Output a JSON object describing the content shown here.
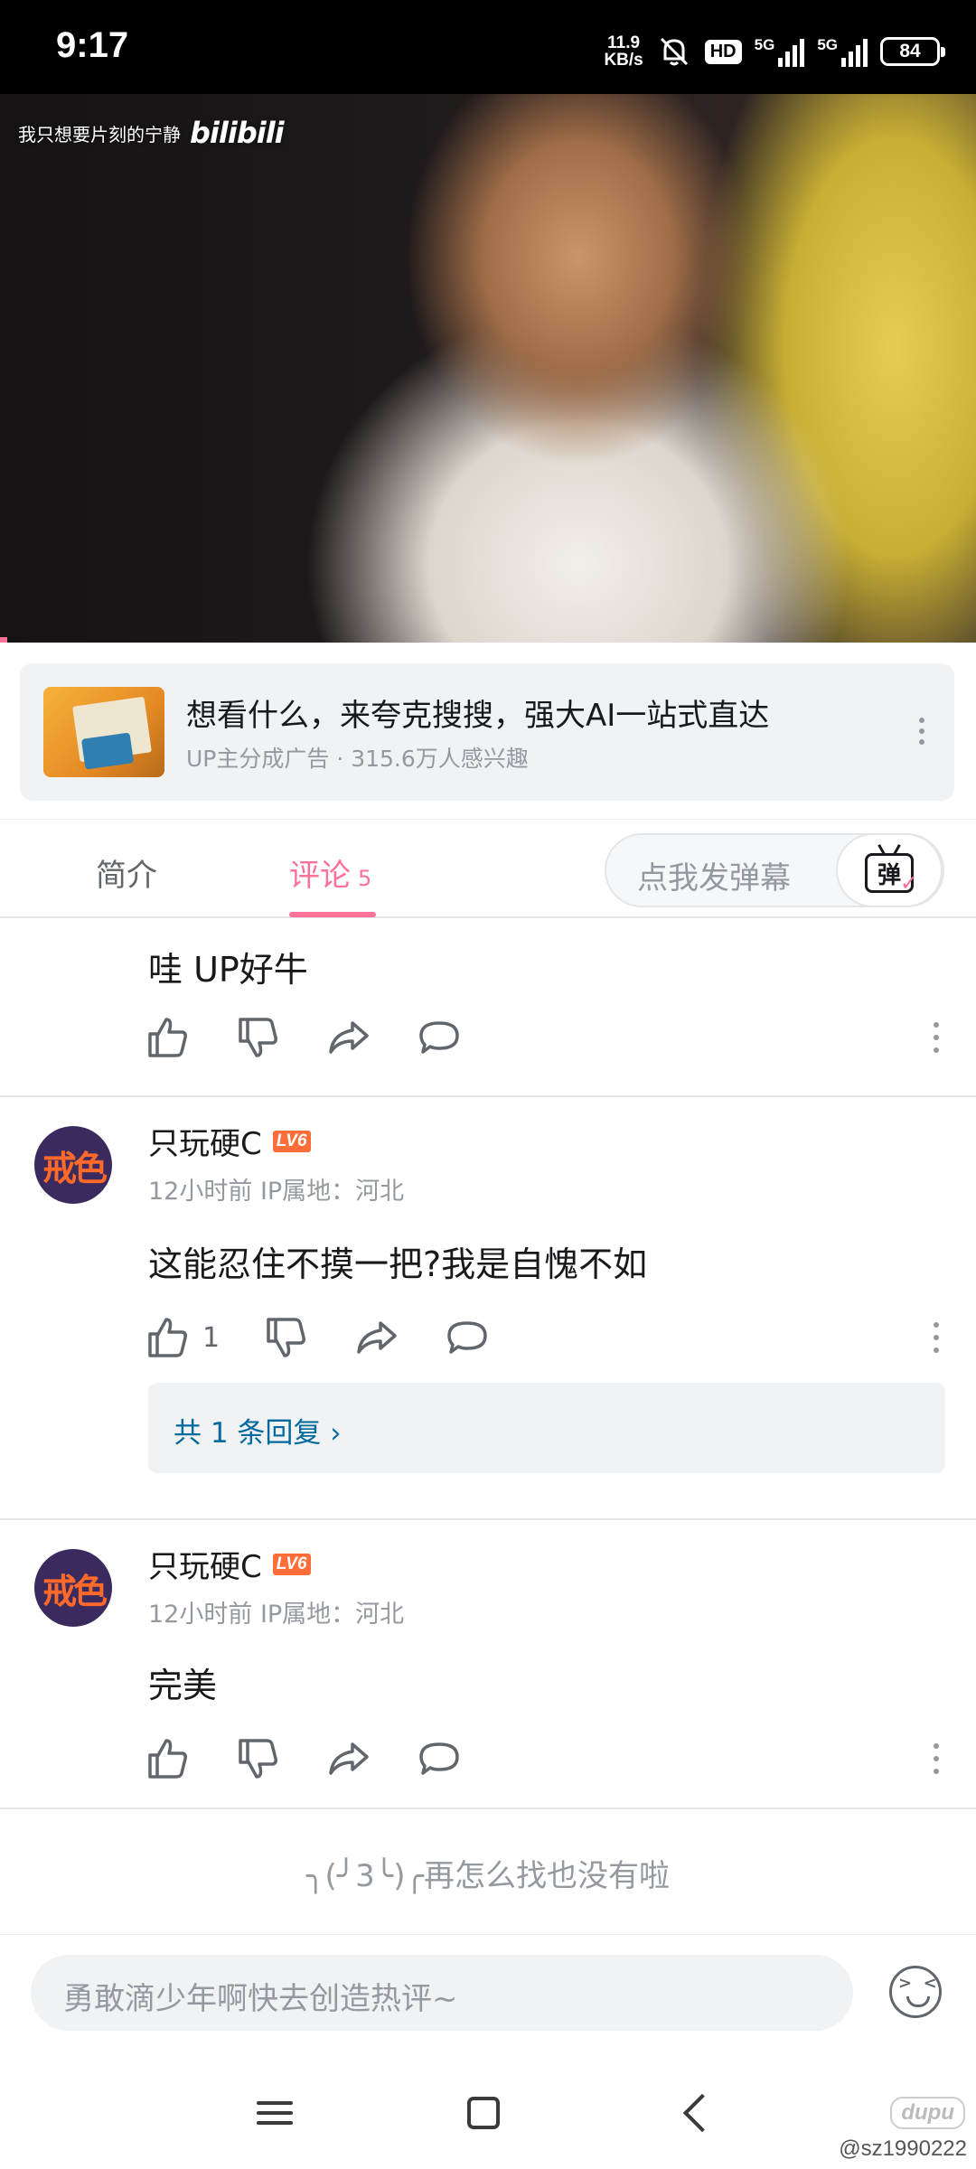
{
  "status_bar": {
    "time": "9:17",
    "net_speed_value": "11.9",
    "net_speed_unit": "KB/s",
    "hd_label": "HD",
    "sim1_label": "5G",
    "sim2_label": "5G",
    "battery": "84"
  },
  "video": {
    "watermark_text": "我只想要片刻的宁静",
    "logo_text": "bilibili"
  },
  "ad": {
    "title": "想看什么，来夸克搜搜，强大AI一站式直达",
    "subtitle": "UP主分成广告 · 315.6万人感兴趣"
  },
  "tabs": {
    "intro": "简介",
    "comments": "评论",
    "comments_count": "5",
    "danmaku_placeholder": "点我发弹幕",
    "danmaku_icon_char": "弹"
  },
  "comments": [
    {
      "text": "哇 UP好牛"
    },
    {
      "avatar_text": "戒色",
      "username": "只玩硬C",
      "level": "LV6",
      "meta": "12小时前 IP属地：河北",
      "text": "这能忍住不摸一把?我是自愧不如",
      "likes": "1",
      "replies_label": "共 1 条回复 ›"
    },
    {
      "avatar_text": "戒色",
      "username": "只玩硬C",
      "level": "LV6",
      "meta": "12小时前 IP属地：河北",
      "text": "完美"
    }
  ],
  "end_text": "╮(╯3╰)╭再怎么找也没有啦",
  "input": {
    "placeholder": "勇敢滴少年啊快去创造热评~"
  },
  "watermark": {
    "logo": "dupu",
    "handle": "@sz1990222"
  }
}
